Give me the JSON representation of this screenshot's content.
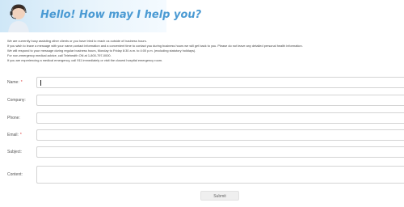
{
  "banner": {
    "heading": "Hello! How may I help you?"
  },
  "notice": {
    "lines": [
      "We are currently busy assisting other clients or you have tried to reach us outside of business hours.",
      "If you wish to leave a message with your name,contact information and a convenient time to contact you during business hours we will get back to you. Please do not leave any detailed personal health information.",
      "We will respond to your message during regular business hours, Monday to Friday 8:30 a.m. to 4:00 p.m. (excluding statutory holidays).",
      "For non-emergency medical advice, call Telehealth ON at 1-800-797-0000.",
      "If you are experiencing a medical emergency, call 911 immediately or visit the closest hospital emergency room."
    ]
  },
  "form": {
    "name_label": "Name:",
    "required_mark": "*",
    "company_label": "Company:",
    "phone_label": "Phone:",
    "email_label": "Email:",
    "subject_label": "Subject:",
    "content_label": "Content:",
    "submit_label": "Submit"
  },
  "colors": {
    "banner_text": "#4a9ad3",
    "required": "#dd3333"
  }
}
